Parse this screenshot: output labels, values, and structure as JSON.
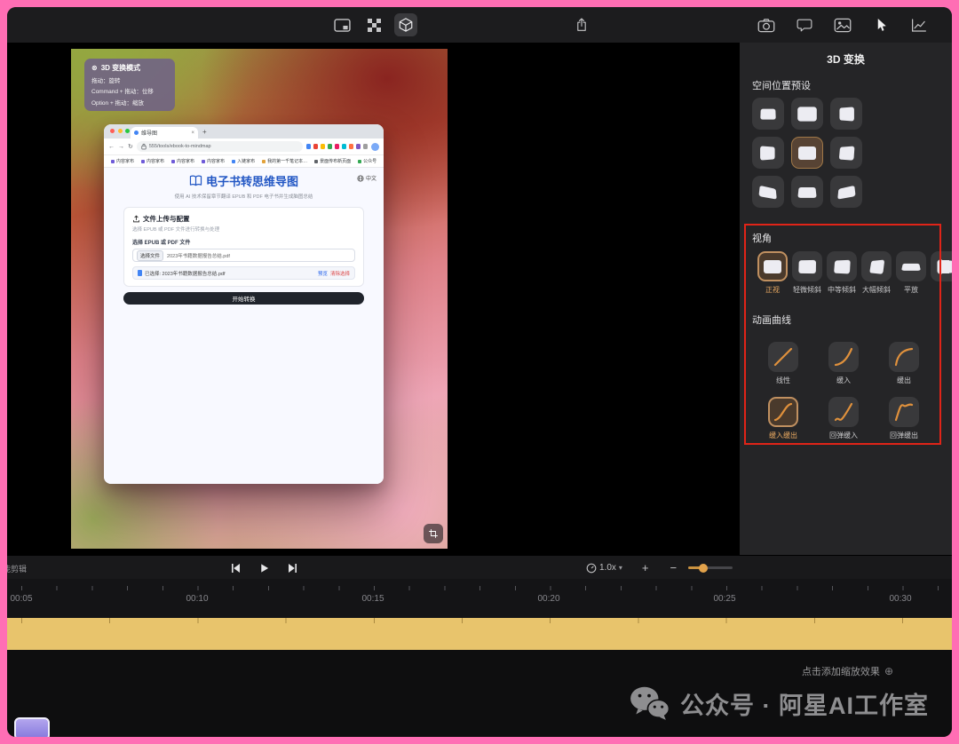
{
  "colors": {
    "frame_pink": "#ff6eb4",
    "accent_orange": "#e0913c",
    "track_yellow": "#e8c46c",
    "highlight_red": "#e02418",
    "page_accent_blue": "#2257c4"
  },
  "tooltip": {
    "icon": "⊗",
    "title": "3D 变换模式",
    "lines": [
      "拖动：旋转",
      "Command + 拖动：位移",
      "Option + 拖动：缩放"
    ]
  },
  "browser": {
    "tab_title": "维导图",
    "tab_close": "×",
    "new_tab": "+",
    "nav": [
      "←",
      "→",
      "↻"
    ],
    "url": "555/tools/ebook-to-mindmap",
    "bookmarks": [
      "内容家布",
      "内容家布",
      "内容家布",
      "内容家布",
      "入链家布",
      "我的第一千笔记本…",
      "景面传布新页面",
      "公众号"
    ],
    "lang_button": "中文",
    "page_title": "电子书转思维导图",
    "page_subtitle": "使用 AI 技术保留章节翻译 EPUB 和 PDF 电子书并生成脑图总结",
    "card_title": "文件上传与配置",
    "card_subtitle": "选择 EPUB 或 PDF 文件进行转换与处理",
    "file_section_label": "选择 EPUB 或 PDF 文件",
    "file_button": "选择文件",
    "file_name": "2023年书籍数据报告总结.pdf",
    "selected_label": "已选择: 2023年书籍数据报告总结.pdf",
    "preview_link": "预览",
    "clear_link": "清除选择",
    "submit_button": "开始转换"
  },
  "panel": {
    "title": "3D 变换",
    "presets_label": "空间位置预设",
    "perspective_label": "视角",
    "perspective_options": [
      "正视",
      "轻微倾斜",
      "中等倾斜",
      "大幅倾斜",
      "平放"
    ],
    "curves_label": "动画曲线",
    "curve_options": [
      "线性",
      "缓入",
      "缓出",
      "缓入缓出",
      "回弹缓入",
      "回弹缓出"
    ]
  },
  "controls": {
    "left_label": "能剪辑",
    "zoom_level": "1.0x",
    "chevron": "▾",
    "plus": "+",
    "minus": "−"
  },
  "timeline": {
    "timestamps": [
      "00:05",
      "00:10",
      "00:15",
      "00:20",
      "00:25",
      "00:30"
    ],
    "hint": "点击添加缩放效果",
    "hint_icon": "⊕"
  },
  "watermark": {
    "text": "公众号 · 阿星AI工作室"
  }
}
